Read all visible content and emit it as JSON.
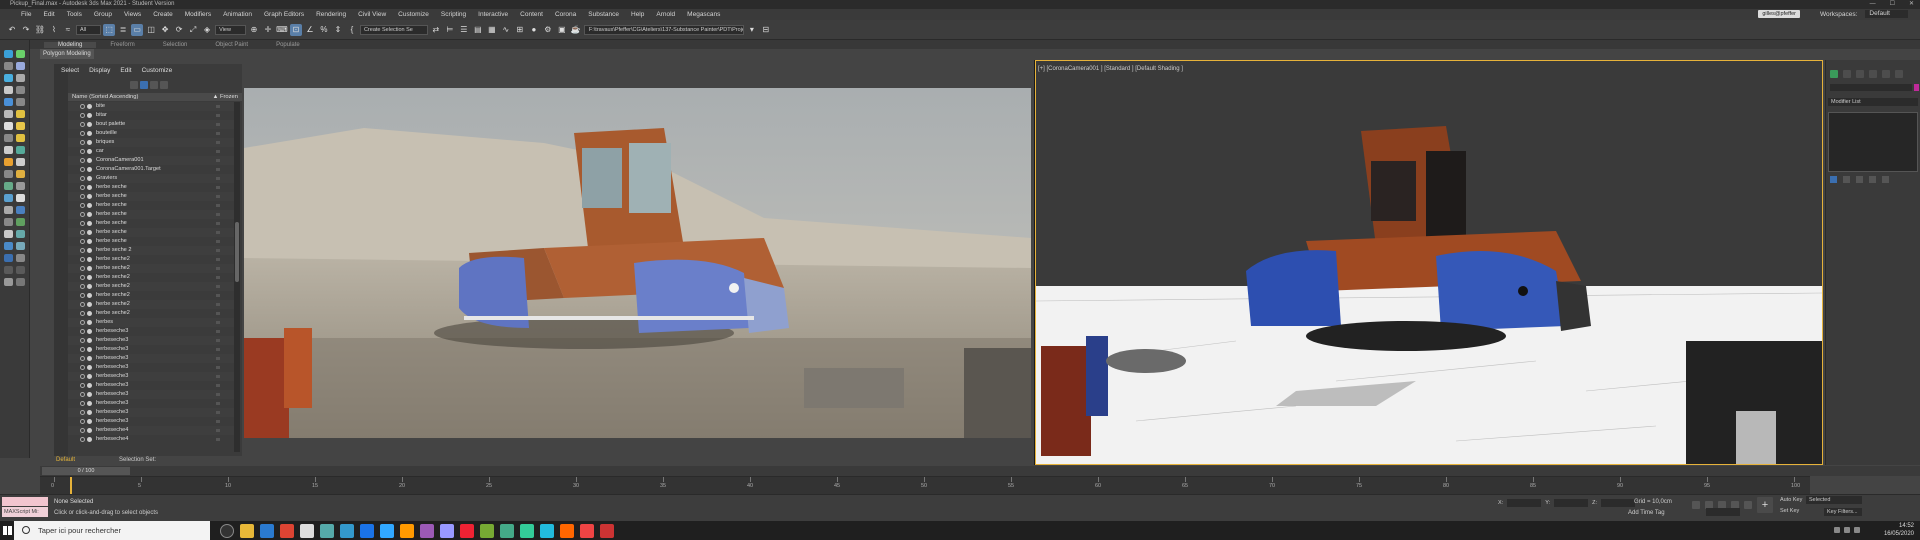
{
  "window": {
    "title": "Pickup_Final.max - Autodesk 3ds Max 2021 - Student Version"
  },
  "menu": [
    "File",
    "Edit",
    "Tools",
    "Group",
    "Views",
    "Create",
    "Modifiers",
    "Animation",
    "Graph Editors",
    "Rendering",
    "Civil View",
    "Customize",
    "Scripting",
    "Interactive",
    "Content",
    "Corona",
    "Substance",
    "Help",
    "Arnold",
    "Megascans"
  ],
  "user": {
    "name": "gilles@pfeffer"
  },
  "workspace": {
    "label": "Workspaces:",
    "value": "Default"
  },
  "toolbar": {
    "filter": "All",
    "view": "View",
    "selection_set": "Create Selection Se",
    "path": "F:\\travaux\\Pfeffer\\CG\\Ateliers\\137-Substance Painter\\PDT\\Projet 3ds Max"
  },
  "ribbon": {
    "tabs": [
      "Modeling",
      "Freeform",
      "Selection",
      "Object Paint",
      "Populate"
    ],
    "active": "Modeling",
    "sub": "Polygon Modeling"
  },
  "explorer": {
    "menu": [
      "Select",
      "Display",
      "Edit",
      "Customize"
    ],
    "header_name": "Name (Sorted Ascending)",
    "header_frozen": "▲ Frozen",
    "items": [
      "bite",
      "bitar",
      "bout palette",
      "bouteille",
      "briques",
      "car",
      "CoronaCamera001",
      "CoronaCamera001.Target",
      "Graviers",
      "herbe seche",
      "herbe seche",
      "herbe seche",
      "herbe seche",
      "herbe seche",
      "herbe seche",
      "herbe seche",
      "herbe seche 2",
      "herbe seche2",
      "herbe seche2",
      "herbe seche2",
      "herbe seche2",
      "herbe seche2",
      "herbe seche2",
      "herbe seche2",
      "herbes",
      "herbeseche3",
      "herbeseche3",
      "herbeseche3",
      "herbeseche3",
      "herbeseche3",
      "herbeseche3",
      "herbeseche3",
      "herbeseche3",
      "herbeseche3",
      "herbeseche3",
      "herbeseche3",
      "herbeseche4",
      "herbeseche4"
    ],
    "layer": "Default",
    "selection_sets": "Selection Set:"
  },
  "viewport2": {
    "label": "[+] [CoronaCamera001 ] [Standard ] [Default Shading ]"
  },
  "command_panel": {
    "modifier_list": "Modifier List"
  },
  "timeline": {
    "slider": "0 / 100",
    "ticks": [
      "0",
      "5",
      "10",
      "15",
      "20",
      "25",
      "30",
      "35",
      "40",
      "45",
      "50",
      "55",
      "60",
      "65",
      "70",
      "75",
      "80",
      "85",
      "90",
      "95",
      "100"
    ]
  },
  "status": {
    "maxscript": "MAXScript Mi:",
    "none_selected": "None Selected",
    "hint": "Click or click-and-drag to select objects",
    "grid": "Grid = 10,0cm",
    "add_time_tag": "Add Time Tag",
    "auto_key": "Auto Key",
    "selected": "Selected",
    "set_key": "Set Key",
    "key_filters": "Key Filters...",
    "x_label": "X:",
    "y_label": "Y:",
    "z_label": "Z:"
  },
  "taskbar": {
    "search": "Taper ici pour rechercher",
    "time": "14:52",
    "date": "16/05/2020"
  },
  "colors": {
    "accent": "#e6b23a",
    "selection": "#3b6fb0"
  }
}
